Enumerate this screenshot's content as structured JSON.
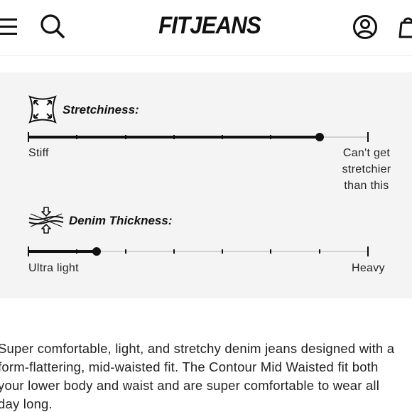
{
  "header": {
    "brand": "FITJEANS",
    "icons": {
      "menu": "menu-icon",
      "search": "search-icon",
      "account": "account-icon",
      "cart": "cart-icon"
    }
  },
  "fit_panel": {
    "stretchiness": {
      "title": "Stretchiness:",
      "icon": "stretch-arrows-icon",
      "min_label": "Stiff",
      "max_label": "Can't get\nstretchier\nthan this",
      "level_fraction": 0.857
    },
    "thickness": {
      "title": "Denim Thickness:",
      "icon": "fabric-thickness-icon",
      "min_label": "Ultra light",
      "max_label": "Heavy",
      "level_fraction": 0.2
    }
  },
  "description": {
    "text": "Super comfortable, light, and stretchy denim jeans designed with a\nform-flattering, mid-waisted fit. The Contour Mid Waisted fit both\nyour lower body and waist and are super comfortable to wear all\nday long."
  }
}
